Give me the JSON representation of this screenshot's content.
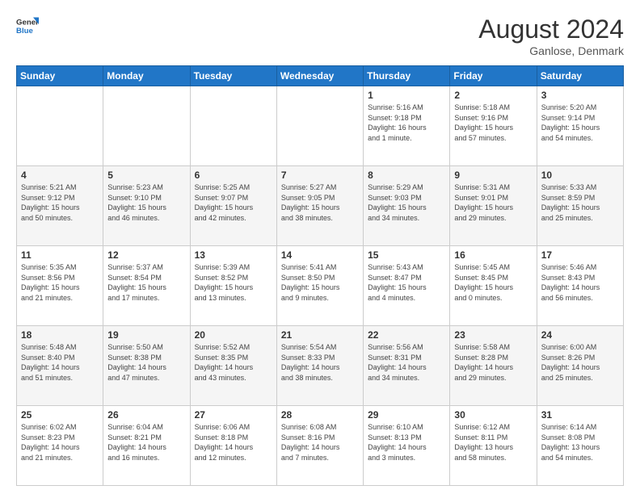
{
  "header": {
    "logo_general": "General",
    "logo_blue": "Blue",
    "title": "August 2024",
    "subtitle": "Ganlose, Denmark"
  },
  "weekdays": [
    "Sunday",
    "Monday",
    "Tuesday",
    "Wednesday",
    "Thursday",
    "Friday",
    "Saturday"
  ],
  "weeks": [
    [
      {
        "day": "",
        "info": ""
      },
      {
        "day": "",
        "info": ""
      },
      {
        "day": "",
        "info": ""
      },
      {
        "day": "",
        "info": ""
      },
      {
        "day": "1",
        "info": "Sunrise: 5:16 AM\nSunset: 9:18 PM\nDaylight: 16 hours\nand 1 minute."
      },
      {
        "day": "2",
        "info": "Sunrise: 5:18 AM\nSunset: 9:16 PM\nDaylight: 15 hours\nand 57 minutes."
      },
      {
        "day": "3",
        "info": "Sunrise: 5:20 AM\nSunset: 9:14 PM\nDaylight: 15 hours\nand 54 minutes."
      }
    ],
    [
      {
        "day": "4",
        "info": "Sunrise: 5:21 AM\nSunset: 9:12 PM\nDaylight: 15 hours\nand 50 minutes."
      },
      {
        "day": "5",
        "info": "Sunrise: 5:23 AM\nSunset: 9:10 PM\nDaylight: 15 hours\nand 46 minutes."
      },
      {
        "day": "6",
        "info": "Sunrise: 5:25 AM\nSunset: 9:07 PM\nDaylight: 15 hours\nand 42 minutes."
      },
      {
        "day": "7",
        "info": "Sunrise: 5:27 AM\nSunset: 9:05 PM\nDaylight: 15 hours\nand 38 minutes."
      },
      {
        "day": "8",
        "info": "Sunrise: 5:29 AM\nSunset: 9:03 PM\nDaylight: 15 hours\nand 34 minutes."
      },
      {
        "day": "9",
        "info": "Sunrise: 5:31 AM\nSunset: 9:01 PM\nDaylight: 15 hours\nand 29 minutes."
      },
      {
        "day": "10",
        "info": "Sunrise: 5:33 AM\nSunset: 8:59 PM\nDaylight: 15 hours\nand 25 minutes."
      }
    ],
    [
      {
        "day": "11",
        "info": "Sunrise: 5:35 AM\nSunset: 8:56 PM\nDaylight: 15 hours\nand 21 minutes."
      },
      {
        "day": "12",
        "info": "Sunrise: 5:37 AM\nSunset: 8:54 PM\nDaylight: 15 hours\nand 17 minutes."
      },
      {
        "day": "13",
        "info": "Sunrise: 5:39 AM\nSunset: 8:52 PM\nDaylight: 15 hours\nand 13 minutes."
      },
      {
        "day": "14",
        "info": "Sunrise: 5:41 AM\nSunset: 8:50 PM\nDaylight: 15 hours\nand 9 minutes."
      },
      {
        "day": "15",
        "info": "Sunrise: 5:43 AM\nSunset: 8:47 PM\nDaylight: 15 hours\nand 4 minutes."
      },
      {
        "day": "16",
        "info": "Sunrise: 5:45 AM\nSunset: 8:45 PM\nDaylight: 15 hours\nand 0 minutes."
      },
      {
        "day": "17",
        "info": "Sunrise: 5:46 AM\nSunset: 8:43 PM\nDaylight: 14 hours\nand 56 minutes."
      }
    ],
    [
      {
        "day": "18",
        "info": "Sunrise: 5:48 AM\nSunset: 8:40 PM\nDaylight: 14 hours\nand 51 minutes."
      },
      {
        "day": "19",
        "info": "Sunrise: 5:50 AM\nSunset: 8:38 PM\nDaylight: 14 hours\nand 47 minutes."
      },
      {
        "day": "20",
        "info": "Sunrise: 5:52 AM\nSunset: 8:35 PM\nDaylight: 14 hours\nand 43 minutes."
      },
      {
        "day": "21",
        "info": "Sunrise: 5:54 AM\nSunset: 8:33 PM\nDaylight: 14 hours\nand 38 minutes."
      },
      {
        "day": "22",
        "info": "Sunrise: 5:56 AM\nSunset: 8:31 PM\nDaylight: 14 hours\nand 34 minutes."
      },
      {
        "day": "23",
        "info": "Sunrise: 5:58 AM\nSunset: 8:28 PM\nDaylight: 14 hours\nand 29 minutes."
      },
      {
        "day": "24",
        "info": "Sunrise: 6:00 AM\nSunset: 8:26 PM\nDaylight: 14 hours\nand 25 minutes."
      }
    ],
    [
      {
        "day": "25",
        "info": "Sunrise: 6:02 AM\nSunset: 8:23 PM\nDaylight: 14 hours\nand 21 minutes."
      },
      {
        "day": "26",
        "info": "Sunrise: 6:04 AM\nSunset: 8:21 PM\nDaylight: 14 hours\nand 16 minutes."
      },
      {
        "day": "27",
        "info": "Sunrise: 6:06 AM\nSunset: 8:18 PM\nDaylight: 14 hours\nand 12 minutes."
      },
      {
        "day": "28",
        "info": "Sunrise: 6:08 AM\nSunset: 8:16 PM\nDaylight: 14 hours\nand 7 minutes."
      },
      {
        "day": "29",
        "info": "Sunrise: 6:10 AM\nSunset: 8:13 PM\nDaylight: 14 hours\nand 3 minutes."
      },
      {
        "day": "30",
        "info": "Sunrise: 6:12 AM\nSunset: 8:11 PM\nDaylight: 13 hours\nand 58 minutes."
      },
      {
        "day": "31",
        "info": "Sunrise: 6:14 AM\nSunset: 8:08 PM\nDaylight: 13 hours\nand 54 minutes."
      }
    ]
  ]
}
